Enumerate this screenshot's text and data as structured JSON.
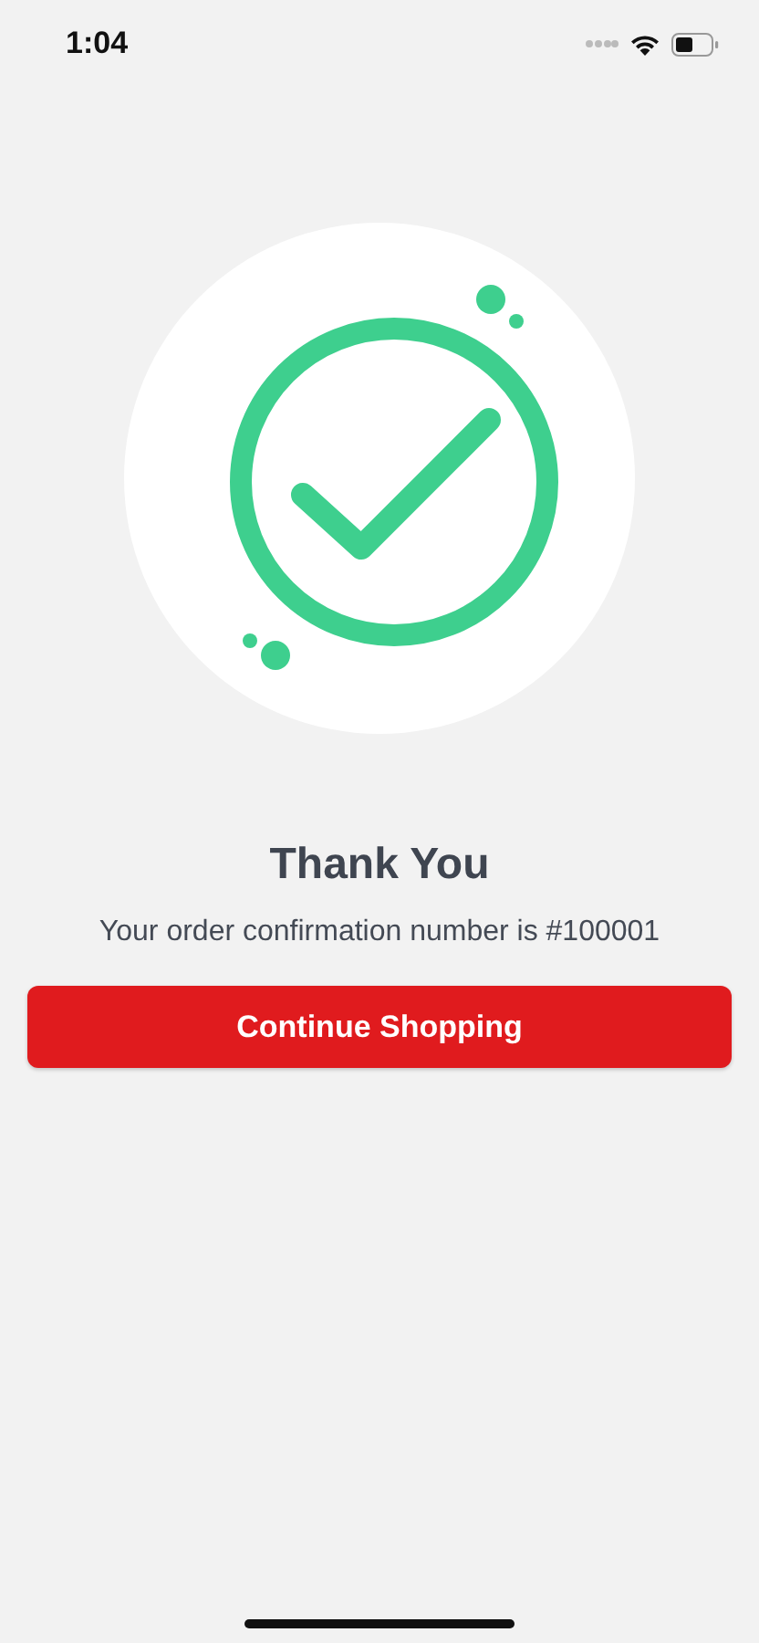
{
  "status_bar": {
    "time": "1:04"
  },
  "title": "Thank You",
  "message": "Your order confirmation number is #100001",
  "button": {
    "label": "Continue Shopping"
  }
}
